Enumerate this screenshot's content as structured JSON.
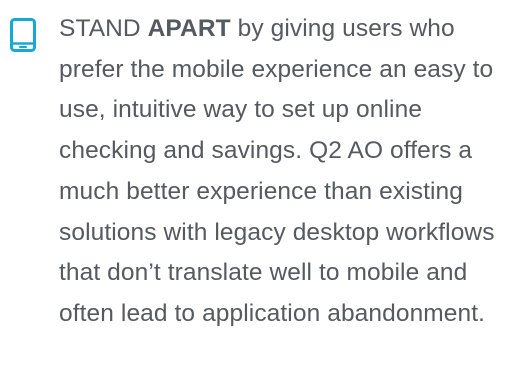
{
  "feature": {
    "icon": "mobile-phone-icon",
    "accent_color": "#16a9d6",
    "text_color": "#555a60",
    "lead_word": "STAND",
    "emphasis_word": "APART",
    "body": "by giving users who prefer the mobile experience an easy to use, intuitive way to set up online checking and savings. Q2 AO offers a much better experience than existing solutions with legacy desktop workflows that don’t translate well to mobile and often lead to application abandonment."
  }
}
